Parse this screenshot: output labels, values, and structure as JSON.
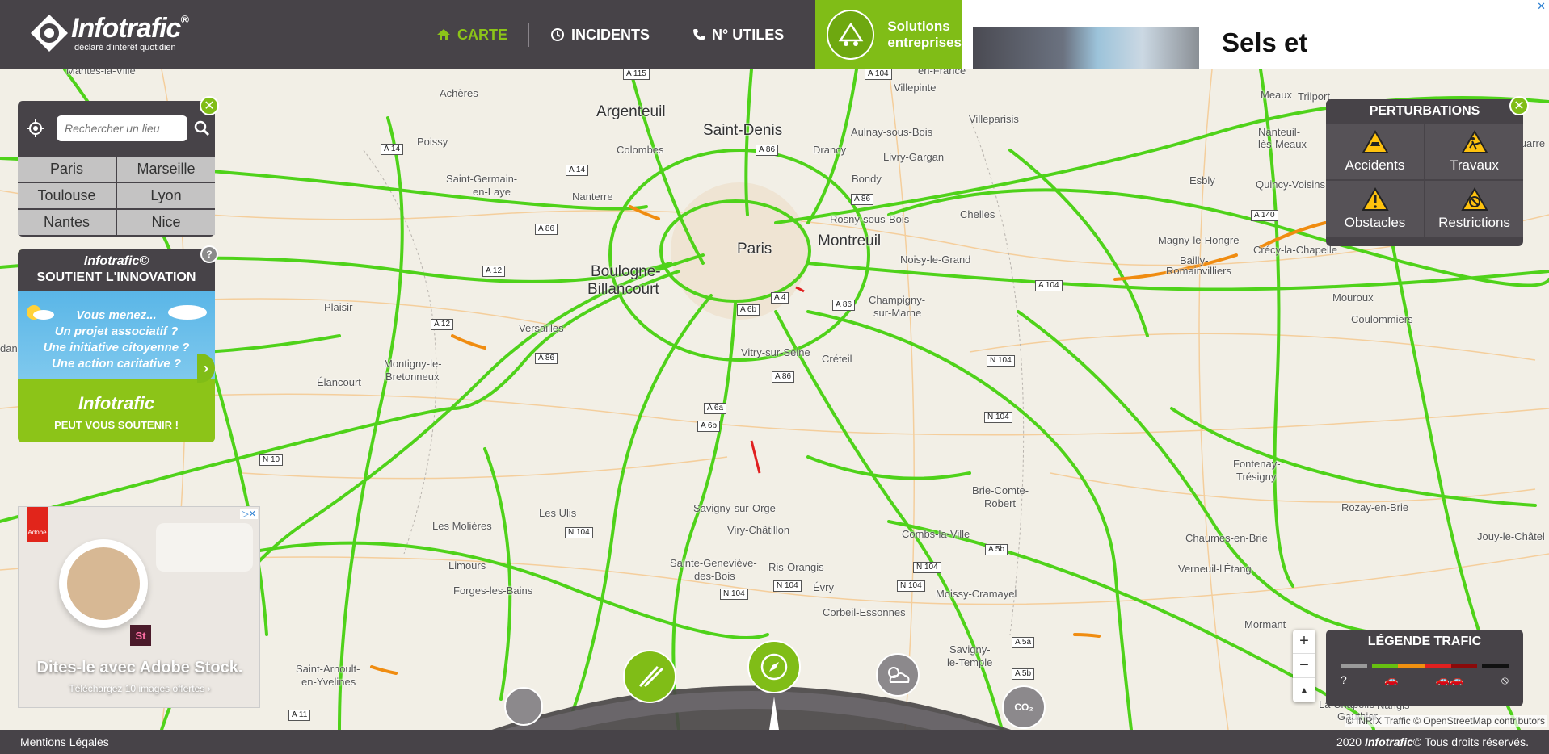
{
  "header": {
    "logo_text": "Infotrafic",
    "logo_reg": "®",
    "logo_tagline": "déclaré d'intérêt quotidien",
    "nav": [
      {
        "label": "CARTE",
        "icon": "home-icon",
        "active": true
      },
      {
        "label": "INCIDENTS",
        "icon": "history-icon",
        "active": false
      },
      {
        "label": "N° UTILES",
        "icon": "phone-icon",
        "active": false
      }
    ],
    "solutions_line1": "Solutions",
    "solutions_line2": "entreprises"
  },
  "top_ad": {
    "text": "Sels et",
    "close": "✕"
  },
  "search": {
    "placeholder": "Rechercher un lieu",
    "cities": [
      "Paris",
      "Marseille",
      "Toulouse",
      "Lyon",
      "Nantes",
      "Nice"
    ]
  },
  "innovation": {
    "title_brand": "Infotrafic©",
    "title_line": "SOUTIENT L'INNOVATION",
    "lines": [
      "Vous menez...",
      "Un projet associatif ?",
      "Une initiative citoyenne ?",
      "Une action caritative ?"
    ],
    "logo": "Infotrafic",
    "footer": "PEUT VOUS SOUTENIR !",
    "help": "?"
  },
  "adobe_ad": {
    "brand": "Adobe",
    "badge": "St",
    "title": "Dites-le avec Adobe Stock.",
    "subtitle": "Téléchargez 10 images offertes ›"
  },
  "perturbations": {
    "title": "PERTURBATIONS",
    "items": [
      {
        "label": "Accidents",
        "icon": "accident-icon"
      },
      {
        "label": "Travaux",
        "icon": "roadwork-icon"
      },
      {
        "label": "Obstacles",
        "icon": "obstacle-icon"
      },
      {
        "label": "Restrictions",
        "icon": "restriction-icon"
      }
    ]
  },
  "legend": {
    "title": "LÉGENDE TRAFIC",
    "colors": [
      "#9a9a9a",
      "#66c010",
      "#f09010",
      "#e02020",
      "#8a0a0a",
      "#111111"
    ],
    "icons": [
      "?",
      "🚗",
      "🚗🚗",
      "⦸"
    ]
  },
  "zoom": {
    "in": "+",
    "out": "−",
    "north": "▲"
  },
  "map": {
    "places_big": [
      "Argenteuil",
      "Saint-Denis",
      "Paris",
      "Montreuil",
      "Boulogne-",
      "Billancourt"
    ],
    "places": [
      "Mantes-la-Ville",
      "Achères",
      "Poissy",
      "Saint-Germain-",
      "en-Laye",
      "Colombes",
      "Nanterre",
      "Aulnay-sous-Bois",
      "Drancy",
      "Bondy",
      "Villepinte",
      "Villeparisis",
      "Livry-Gargan",
      "Rosny-sous-Bois",
      "Chelles",
      "Noisy-le-Grand",
      "Champigny-",
      "sur-Marne",
      "Vitry-sur-Seine",
      "Créteil",
      "Plaisir",
      "Versailles",
      "Élancourt",
      "Montigny-le-",
      "Bretonneux",
      "Les Ulis",
      "Savigny-sur-Orge",
      "Viry-Châtillon",
      "Sainte-Geneviève-",
      "des-Bois",
      "Ris-Orangis",
      "Évry",
      "Corbeil-Essonnes",
      "Les Molières",
      "Limours",
      "Forges-les-Bains",
      "Saint-Arnoult-",
      "en-Yvelines",
      "Brie-Comte-",
      "Robert",
      "Combs-la-Ville",
      "Moissy-Cramayel",
      "Savigny-",
      "le-Temple",
      "Meaux",
      "Trilport",
      "Nanteuil-",
      "lès-Meaux",
      "Esbly",
      "Quincy-Voisins",
      "Magny-le-Hongre",
      "Bailly-",
      "Romainvilliers",
      "Crécy-la-Chapelle",
      "Mouroux",
      "Coulommiers",
      "Jouarre",
      "Fontenay-",
      "Trésigny",
      "Rozay-en-Brie",
      "Chaumes-en-Brie",
      "Verneuil-l'Étang",
      "Jouy-le-Châtel",
      "Mormant",
      "La Chapelle-",
      "Gauthier",
      "Nangis",
      "dan",
      "en-France"
    ],
    "roads": [
      "A 115",
      "A 104",
      "A 14",
      "A 86",
      "A 14",
      "A 86",
      "A 86",
      "A 12",
      "A 12",
      "A 86",
      "A 4",
      "A 6b",
      "A 86",
      "A 86",
      "A 6a",
      "A 6b",
      "N 10",
      "N 104",
      "A 104",
      "N 104",
      "N 104",
      "A 140",
      "N 104",
      "N 104",
      "N 104",
      "N 104",
      "A 5b",
      "A 5a",
      "A 5b",
      "A 11"
    ]
  },
  "footer": {
    "legal": "Mentions Légales",
    "copyright_pre": "2020",
    "copyright_brand": "Infotrafic",
    "copyright_post": "© Tous droits réservés.",
    "attribution": "© INRIX Traffic © OpenStreetMap contributors"
  }
}
